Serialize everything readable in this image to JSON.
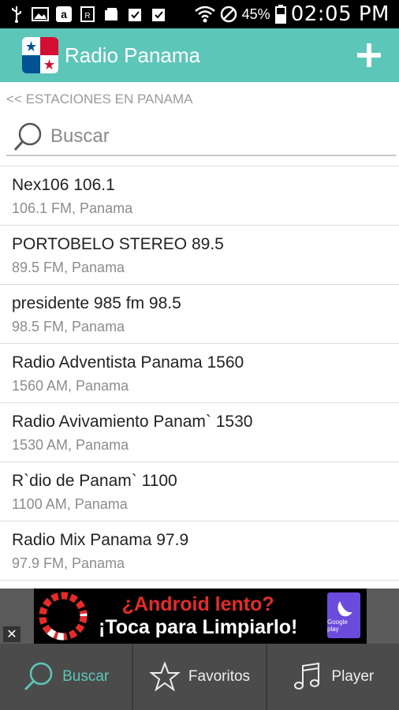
{
  "status_bar": {
    "battery": "45%",
    "time": "02:05 PM"
  },
  "app_bar": {
    "title": "Radio Panama",
    "add_button": "+"
  },
  "back_link": "<< ESTACIONES EN PANAMA",
  "search": {
    "placeholder": "Buscar",
    "value": ""
  },
  "stations": [
    {
      "name": "Nex106 106.1",
      "info": "106.1 FM, Panama"
    },
    {
      "name": "PORTOBELO STEREO 89.5",
      "info": "89.5 FM, Panama"
    },
    {
      "name": "presidente 985 fm 98.5",
      "info": "98.5 FM, Panama"
    },
    {
      "name": "Radio Adventista Panama 1560",
      "info": "1560 AM, Panama"
    },
    {
      "name": "Radio Avivamiento Panam` 1530",
      "info": "1530 AM, Panama"
    },
    {
      "name": "R`dio de Panam` 1100",
      "info": "1100 AM, Panama"
    },
    {
      "name": "Radio Mix Panama 97.9",
      "info": "97.9 FM, Panama"
    }
  ],
  "ad": {
    "line1": "¿Android lento?",
    "line2": "¡Toca para Limpiarlo!",
    "close": "✕",
    "logo_caption": "Google play"
  },
  "bottom_nav": {
    "items": [
      {
        "label": "Buscar",
        "icon": "search-icon"
      },
      {
        "label": "Favoritos",
        "icon": "star-icon"
      },
      {
        "label": "Player",
        "icon": "music-note-icon"
      }
    ]
  },
  "colors": {
    "accent": "#5cc6b9",
    "nav_bg": "#4b4b4b",
    "ad_red": "#e52b2b"
  }
}
